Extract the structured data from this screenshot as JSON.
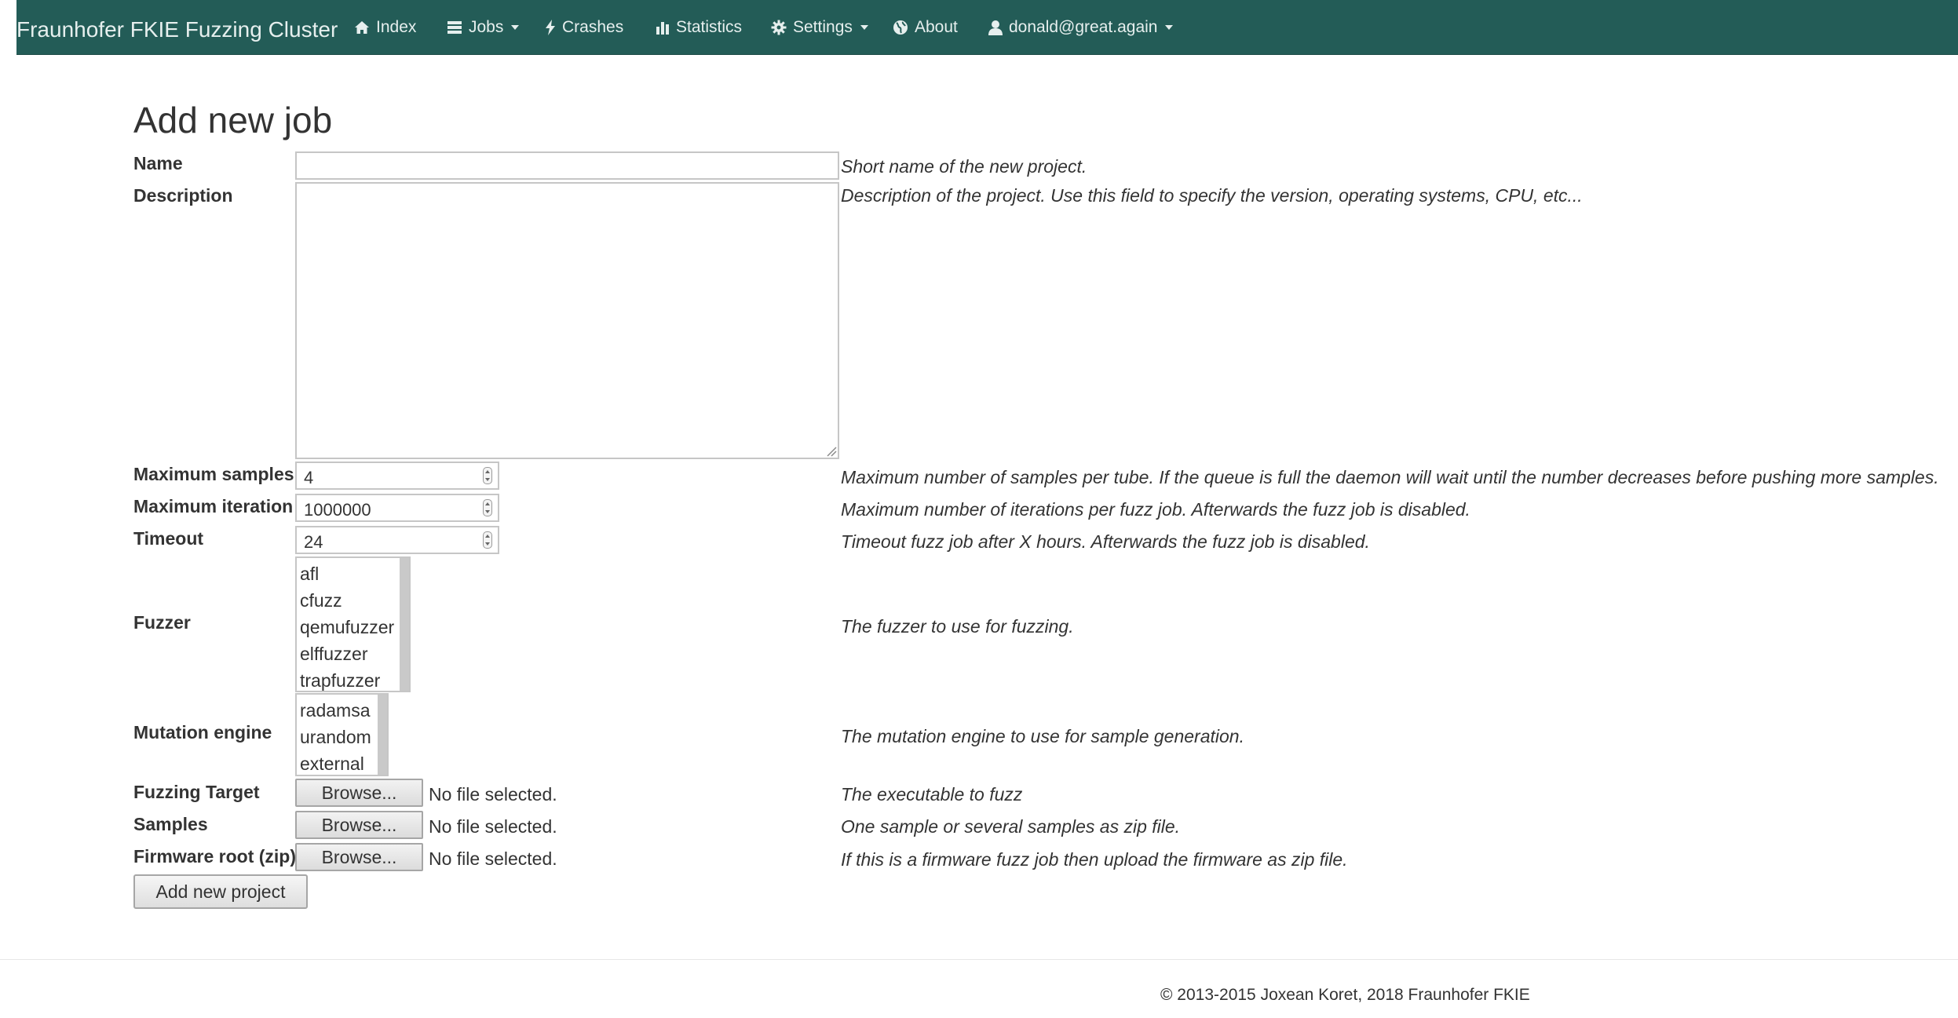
{
  "navbar": {
    "brand": "Fraunhofer FKIE Fuzzing Cluster",
    "background_color": "#235c57",
    "items": [
      {
        "label": "Index",
        "icon": "home-icon",
        "dropdown": false
      },
      {
        "label": "Jobs",
        "icon": "list-icon",
        "dropdown": true
      },
      {
        "label": "Crashes",
        "icon": "bolt-icon",
        "dropdown": false
      },
      {
        "label": "Statistics",
        "icon": "bar-chart-icon",
        "dropdown": false
      },
      {
        "label": "Settings",
        "icon": "gear-icon",
        "dropdown": true
      },
      {
        "label": "About",
        "icon": "globe-icon",
        "dropdown": false
      },
      {
        "label": "donald@great.again",
        "icon": "user-icon",
        "dropdown": true
      }
    ]
  },
  "page": {
    "title": "Add new job"
  },
  "form": {
    "name": {
      "label": "Name",
      "value": "",
      "help": "Short name of the new project."
    },
    "description": {
      "label": "Description",
      "value": "",
      "help": "Description of the project. Use this field to specify the version, operating systems, CPU, etc..."
    },
    "max_samples": {
      "label": "Maximum samples",
      "value": "4",
      "help": "Maximum number of samples per tube. If the queue is full the daemon will wait until the number decreases before pushing more samples."
    },
    "max_iteration": {
      "label": "Maximum iteration",
      "value": "1000000",
      "help": "Maximum number of iterations per fuzz job. Afterwards the fuzz job is disabled."
    },
    "timeout": {
      "label": "Timeout",
      "value": "24",
      "help": "Timeout fuzz job after X hours. Afterwards the fuzz job is disabled."
    },
    "fuzzer": {
      "label": "Fuzzer",
      "options": [
        "afl",
        "cfuzz",
        "qemufuzzer",
        "elffuzzer",
        "trapfuzzer"
      ],
      "help": "The fuzzer to use for fuzzing."
    },
    "mutation_engine": {
      "label": "Mutation engine",
      "options": [
        "radamsa",
        "urandom",
        "external"
      ],
      "help": "The mutation engine to use for sample generation."
    },
    "fuzzing_target": {
      "label": "Fuzzing Target",
      "button": "Browse...",
      "status": "No file selected.",
      "help": "The executable to fuzz"
    },
    "samples": {
      "label": "Samples",
      "button": "Browse...",
      "status": "No file selected.",
      "help": "One sample or several samples as zip file."
    },
    "firmware_root": {
      "label": "Firmware root (zip)",
      "button": "Browse...",
      "status": "No file selected.",
      "help": "If this is a firmware fuzz job then upload the firmware as zip file."
    },
    "submit_label": "Add new project"
  },
  "footer": {
    "text": "© 2013-2015 Joxean Koret, 2018 Fraunhofer FKIE"
  }
}
